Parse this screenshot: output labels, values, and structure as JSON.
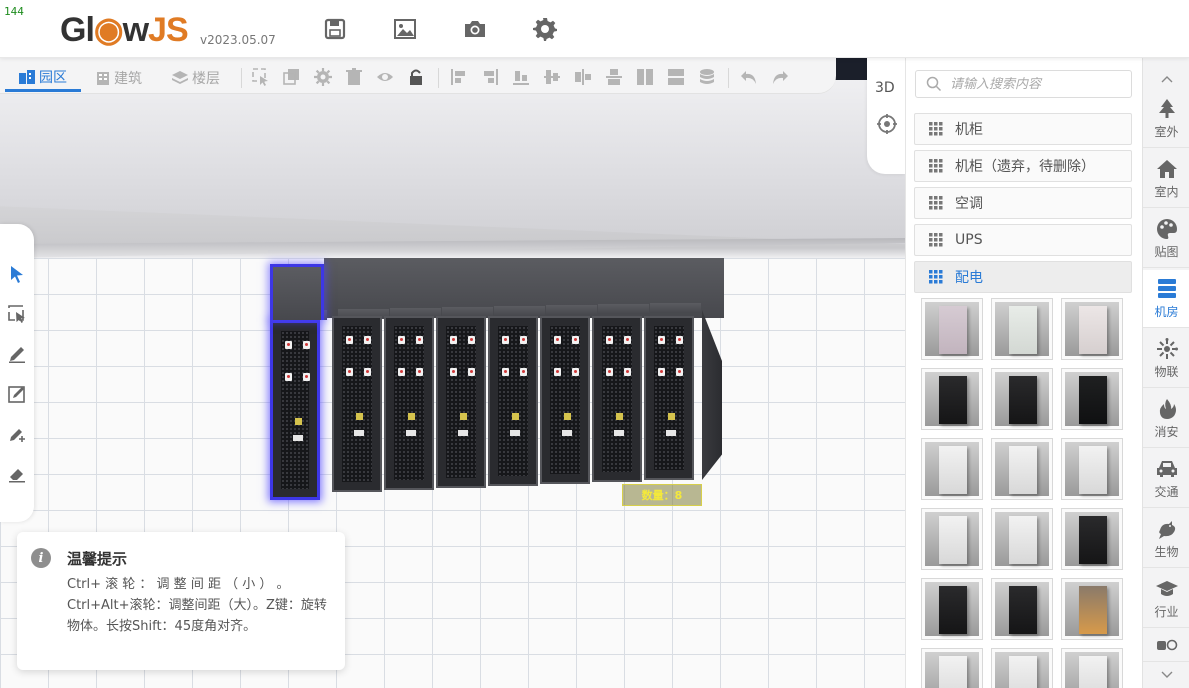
{
  "fps": "144",
  "app": {
    "logo_prefix": "Gl",
    "logo_mid": "w",
    "logo_suffix": "JS",
    "version": "v2023.05.07"
  },
  "header_icons": [
    "save-icon",
    "image-icon",
    "camera-icon",
    "settings-icon"
  ],
  "toolbar": {
    "tabs": [
      {
        "label": "园区",
        "icon": "park-icon",
        "active": true
      },
      {
        "label": "建筑",
        "icon": "building-icon",
        "active": false
      },
      {
        "label": "楼层",
        "icon": "layers-icon",
        "active": false
      }
    ],
    "buttons": [
      "select-box-icon",
      "copy-icon",
      "gear-icon",
      "trash-icon",
      "eye-icon",
      "lock-icon",
      "align-left-icon",
      "align-right-icon",
      "align-bottom-icon",
      "align-center-h-icon",
      "distribute-h-icon",
      "distribute-v-icon",
      "align-columns-icon",
      "align-rows-icon",
      "stack-icon",
      "undo-icon",
      "redo-icon"
    ]
  },
  "view_tools": {
    "label_3d": "3D"
  },
  "left_tools": [
    "pointer-icon",
    "select-tool-icon",
    "pen-icon",
    "edit-box-icon",
    "add-point-icon",
    "eraser-icon"
  ],
  "scene": {
    "count_label": "数量：8",
    "cabinet_count": 8
  },
  "tip": {
    "title": "温馨提示",
    "body": "Ctrl+ 滚 轮 ： 调 整 间 距 （ 小 ） 。 Ctrl+Alt+滚轮：调整间距（大）。Z键：旋转物体。长按Shift：45度角对齐。"
  },
  "panel": {
    "search_placeholder": "请输入搜索内容",
    "categories": [
      {
        "label": "机柜",
        "active": false
      },
      {
        "label": "机柜（遗弃，待删除）",
        "active": false
      },
      {
        "label": "空调",
        "active": false
      },
      {
        "label": "UPS",
        "active": false
      },
      {
        "label": "配电",
        "active": true
      }
    ],
    "thumbnails": [
      "lightpink",
      "panel",
      "white-cabinet",
      "black",
      "black",
      "black-tall",
      "white",
      "white",
      "white",
      "white",
      "white",
      "black",
      "black",
      "black",
      "orange",
      "white",
      "white",
      "white"
    ]
  },
  "sidebar": {
    "items": [
      {
        "label": "室外",
        "icon": "tree-icon",
        "active": false
      },
      {
        "label": "室内",
        "icon": "home-icon",
        "active": false
      },
      {
        "label": "贴图",
        "icon": "palette-icon",
        "active": false
      },
      {
        "label": "机房",
        "icon": "server-icon",
        "active": true
      },
      {
        "label": "物联",
        "icon": "iot-icon",
        "active": false
      },
      {
        "label": "消安",
        "icon": "fire-icon",
        "active": false
      },
      {
        "label": "交通",
        "icon": "car-icon",
        "active": false
      },
      {
        "label": "生物",
        "icon": "bird-icon",
        "active": false
      },
      {
        "label": "行业",
        "icon": "graduation-icon",
        "active": false
      }
    ]
  },
  "colors": {
    "accent": "#2a7bd6",
    "selection": "#3d37e6",
    "logo_orange": "#e07b24"
  }
}
